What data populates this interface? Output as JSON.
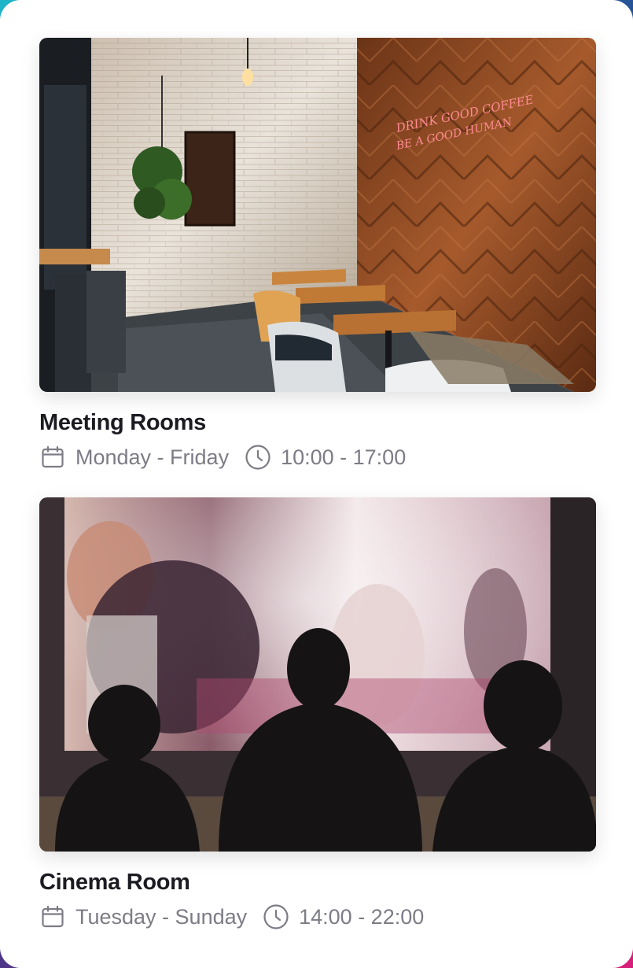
{
  "rooms": [
    {
      "title": "Meeting Rooms",
      "days": "Monday - Friday",
      "hours": "10:00 - 17:00",
      "image_icon": "cafe-photo",
      "neon_text": [
        "DRINK GOOD COFFEE",
        "BE A GOOD HUMAN"
      ]
    },
    {
      "title": "Cinema Room",
      "days": "Tuesday - Sunday",
      "hours": "14:00 - 22:00",
      "image_icon": "cinema-photo"
    }
  ],
  "icons": {
    "calendar": "calendar-icon",
    "clock": "clock-icon"
  },
  "colors": {
    "title": "#1b1b22",
    "meta": "#7c7c86",
    "neon": "#ff6f7a"
  }
}
